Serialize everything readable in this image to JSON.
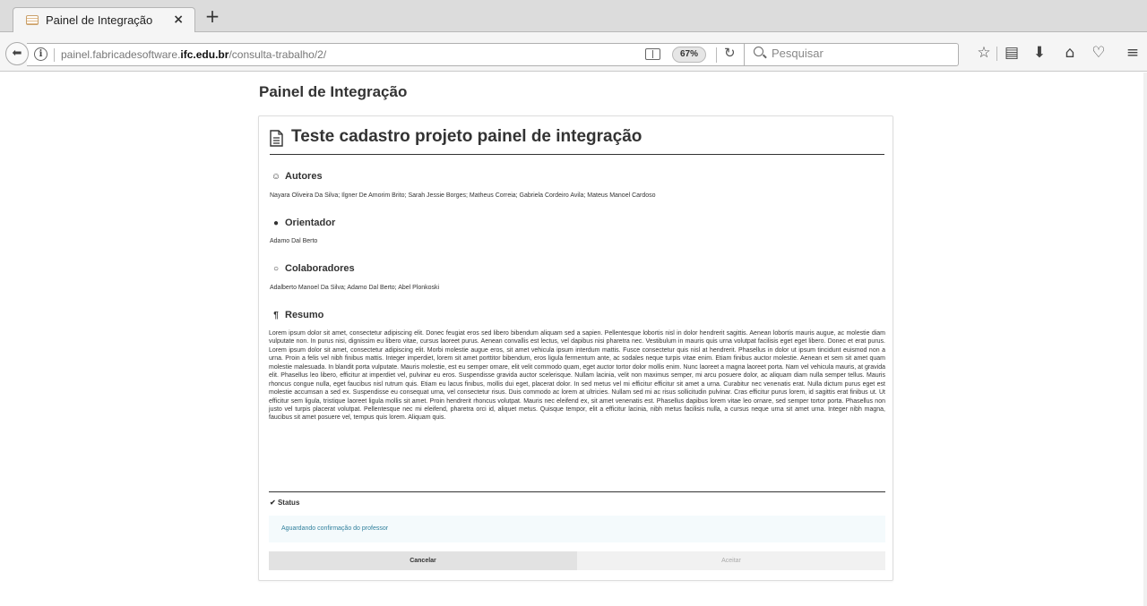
{
  "browser": {
    "tab_title": "Painel de Integração",
    "tab_close": "×",
    "new_tab": "+",
    "url_prefix": "painel.fabricadesoftware.",
    "url_domain": "ifc.edu.br",
    "url_path": "/consulta-trabalho/2/",
    "zoom": "67%",
    "search_placeholder": "Pesquisar",
    "icons": [
      "back-icon",
      "info-icon",
      "reader-icon",
      "reload-icon",
      "search-icon",
      "star-icon",
      "library-icon",
      "download-icon",
      "home-icon",
      "pocket-icon",
      "menu-icon"
    ]
  },
  "page": {
    "heading": "Painel de Integração",
    "title": "Teste cadastro projeto painel de integração",
    "sections": {
      "autores": {
        "label": "Autores",
        "text": "Nayara Oliveira Da Silva; Ilgner De Amorim Brito; Sarah Jessie Borges; Matheus Correia; Gabriela Cordeiro Avila; Mateus Manoel Cardoso"
      },
      "orientador": {
        "label": "Orientador",
        "text": "Adamo Dal Berto"
      },
      "colaboradores": {
        "label": "Colaboradores",
        "text": "Adalberto Manoel Da Silva; Adamo Dal Berto; Abel Plonkoski"
      },
      "resumo": {
        "label": "Resumo",
        "text": "Lorem ipsum dolor sit amet, consectetur adipiscing elit. Donec feugiat eros sed libero bibendum aliquam sed a sapien. Pellentesque lobortis nisl in dolor hendrerit sagittis. Aenean lobortis mauris augue, ac molestie diam vulputate non. In purus nisi, dignissim eu libero vitae, cursus laoreet purus. Aenean convallis est lectus, vel dapibus nisi pharetra nec. Vestibulum in mauris quis urna volutpat facilisis eget eget libero. Donec et erat purus. Lorem ipsum dolor sit amet, consectetur adipiscing elit. Morbi molestie augue eros, sit amet vehicula ipsum interdum mattis. Fusce consectetur quis nisl at hendrerit. Phasellus in dolor ut ipsum tincidunt euismod non a urna. Proin a felis vel nibh finibus mattis. Integer imperdiet, lorem sit amet porttitor bibendum, eros ligula fermentum ante, ac sodales neque turpis vitae enim. Etiam finibus auctor molestie. Aenean et sem sit amet quam molestie malesuada. In blandit porta vulputate. Mauris molestie, est eu semper ornare, elit velit commodo quam, eget auctor tortor dolor mollis enim. Nunc laoreet a magna laoreet porta. Nam vel vehicula mauris, at gravida elit. Phasellus leo libero, efficitur at imperdiet vel, pulvinar eu eros. Suspendisse gravida auctor scelerisque. Nullam lacinia, velit non maximus semper, mi arcu posuere dolor, ac aliquam diam nulla semper tellus. Mauris rhoncus congue nulla, eget faucibus nisl rutrum quis. Etiam eu lacus finibus, mollis dui eget, placerat dolor. In sed metus vel mi efficitur efficitur sit amet a urna. Curabitur nec venenatis erat. Nulla dictum purus eget est molestie accumsan a sed ex. Suspendisse eu consequat urna, vel consectetur risus. Duis commodo ac lorem at ultricies. Nullam sed mi ac risus sollicitudin pulvinar. Cras efficitur purus lorem, id sagittis erat finibus ut. Ut efficitur sem ligula, tristique laoreet ligula mollis sit amet. Proin hendrerit rhoncus volutpat. Mauris nec eleifend ex, sit amet venenatis est. Phasellus dapibus lorem vitae leo ornare, sed semper tortor porta. Phasellus non justo vel turpis placerat volutpat. Pellentesque nec mi eleifend, pharetra orci id, aliquet metus. Quisque tempor, elit a efficitur lacinia, nibh metus facilisis nulla, a cursus neque urna sit amet urna. Integer nibh magna, faucibus sit amet posuere vel, tempus quis lorem. Aliquam quis."
      },
      "status": {
        "label": "Status",
        "text": "Aguardando confirmação do professor"
      }
    },
    "buttons": {
      "cancel": "Cancelar",
      "accept": "Aceitar"
    }
  },
  "colors": {
    "status_text": "#2f7f9c",
    "status_bg": "#f4fafc"
  }
}
